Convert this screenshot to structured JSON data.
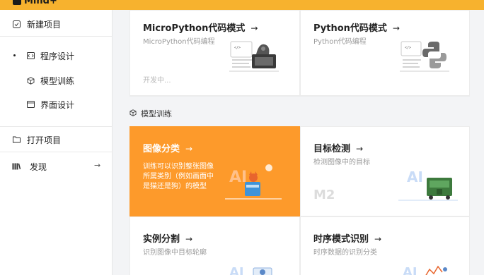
{
  "app": {
    "logo_text": "Mind+"
  },
  "sidebar": {
    "items": [
      {
        "label": "新建项目",
        "icon": "new-project-icon"
      },
      {
        "label": "程序设计",
        "icon": "code-design-icon"
      },
      {
        "label": "模型训练",
        "icon": "cube-icon"
      },
      {
        "label": "界面设计",
        "icon": "window-icon"
      },
      {
        "label": "打开项目",
        "icon": "folder-icon"
      },
      {
        "label": "发现",
        "icon": "discover-icon",
        "trailing": "→"
      }
    ]
  },
  "main": {
    "top_cards": [
      {
        "title": "MicroPython代码模式",
        "arrow": "→",
        "desc": "MicroPython代码编程",
        "status": "开发中..."
      },
      {
        "title": "Python代码模式",
        "arrow": "→",
        "desc": "Python代码编程"
      }
    ],
    "section": {
      "label": "模型训练",
      "icon": "cube-icon"
    },
    "model_cards": [
      {
        "title": "图像分类",
        "arrow": "→",
        "desc_lines": [
          "训练可以识别整张图像",
          "所属类别（例如画面中",
          "是猫还是狗）的模型"
        ]
      },
      {
        "title": "目标检测",
        "arrow": "→",
        "desc": "检测图像中的目标",
        "badge": "M2"
      },
      {
        "title": "实例分割",
        "arrow": "→",
        "desc": "识别图像中目标轮廓"
      },
      {
        "title": "时序模式识别",
        "arrow": "→",
        "desc": "时序数据的识别分类"
      }
    ]
  },
  "colors": {
    "topbar": "#f7b22e",
    "active_card": "#fd9a2b",
    "accent_blue": "#3b6fd9"
  }
}
